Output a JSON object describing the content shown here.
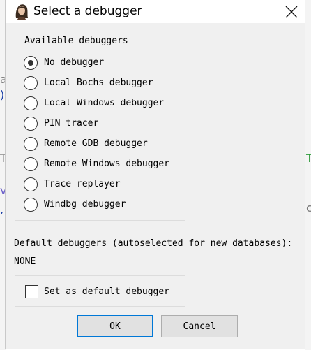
{
  "window": {
    "title": "Select a debugger",
    "app_icon": "portrait-icon",
    "close_icon": "close-icon"
  },
  "debuggers_group": {
    "legend": "Available debuggers",
    "selected_index": 0,
    "options": [
      {
        "label": "No debugger",
        "selected": true
      },
      {
        "label": "Local Bochs debugger",
        "selected": false
      },
      {
        "label": "Local Windows debugger",
        "selected": false
      },
      {
        "label": "PIN tracer",
        "selected": false
      },
      {
        "label": "Remote GDB debugger",
        "selected": false
      },
      {
        "label": "Remote Windows debugger",
        "selected": false
      },
      {
        "label": "Trace replayer",
        "selected": false
      },
      {
        "label": "Windbg debugger",
        "selected": false
      }
    ]
  },
  "defaults": {
    "label": "Default debuggers (autoselected for new databases):",
    "value": "NONE",
    "checkbox_label": "Set as default debugger",
    "checkbox_checked": false
  },
  "buttons": {
    "ok": "OK",
    "cancel": "Cancel"
  },
  "colors": {
    "dialog_bg": "#f0f0f0",
    "focus_border": "#0078d7",
    "button_bg": "#e1e1e1"
  }
}
